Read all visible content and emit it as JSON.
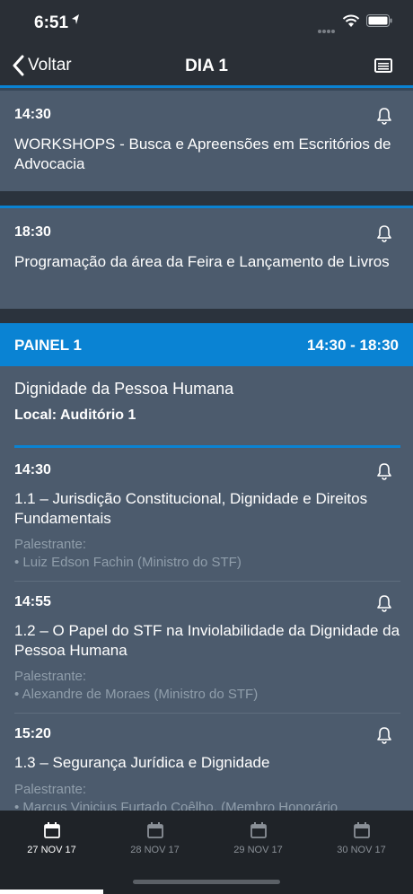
{
  "status": {
    "time": "6:51"
  },
  "nav": {
    "back_label": "Voltar",
    "title": "DIA 1"
  },
  "events": [
    {
      "time": "14:30",
      "title": "WORKSHOPS - Busca e Apreensões em Escritórios de Advocacia"
    },
    {
      "time": "18:30",
      "title": "Programação da área da Feira e Lançamento de Livros"
    }
  ],
  "painel": {
    "name": "PAINEL 1",
    "range": "14:30 - 18:30",
    "title": "Dignidade da Pessoa Humana",
    "local": "Local: Auditório 1",
    "sessions": [
      {
        "time": "14:30",
        "title": "1.1 – Jurisdição Constitucional, Dignidade e Direitos Fundamentais",
        "speaker_label": "Palestrante:",
        "speaker": "• Luiz Edson Fachin (Ministro do STF)"
      },
      {
        "time": "14:55",
        "title": "1.2 – O Papel do STF na Inviolabilidade da Dignidade da Pessoa Humana",
        "speaker_label": "Palestrante:",
        "speaker": "• Alexandre de Moraes (Ministro do STF)"
      },
      {
        "time": "15:20",
        "title": "1.3 – Segurança Jurídica e Dignidade",
        "speaker_label": "Palestrante:",
        "speaker": "• Marcus Vinicius Furtado Coêlho, (Membro Honorário"
      }
    ]
  },
  "tabs": [
    {
      "label": "27 NOV 17",
      "active": true
    },
    {
      "label": "28 NOV 17",
      "active": false
    },
    {
      "label": "29 NOV 17",
      "active": false
    },
    {
      "label": "30 NOV 17",
      "active": false
    }
  ],
  "icons": {
    "bell": "bell-icon",
    "calendar": "calendar-icon",
    "back": "chevron-left-icon",
    "menu": "list-icon"
  },
  "colors": {
    "accent": "#0a83d3",
    "card": "#4c5b6d",
    "bar": "#2a2f36",
    "muted": "#909eab"
  }
}
